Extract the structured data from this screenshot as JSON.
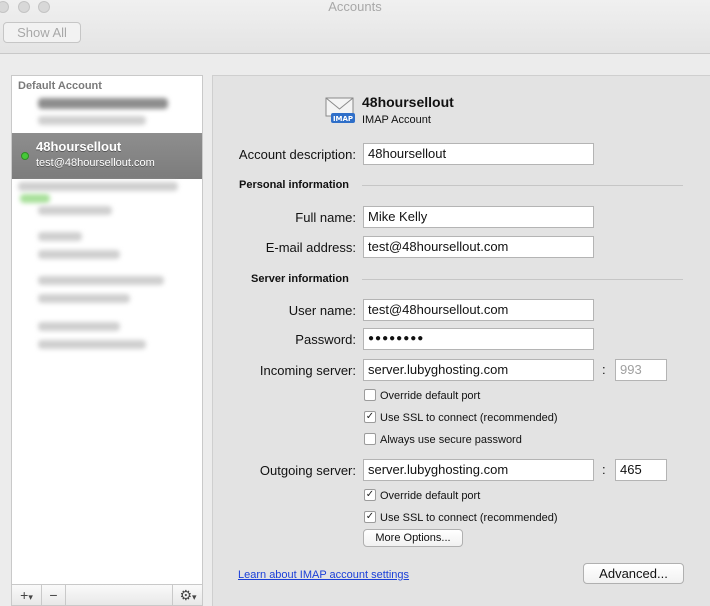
{
  "window": {
    "title": "Accounts"
  },
  "toolbar": {
    "show_all_label": "Show All"
  },
  "sidebar": {
    "header": "Default Account",
    "selected": {
      "name": "48hoursellout",
      "email": "test@48hoursellout.com"
    },
    "add_label": "+",
    "remove_label": "−",
    "add_menu_label": "▾",
    "gear_label": "⚙",
    "gear_menu_label": "▾"
  },
  "account": {
    "title": "48hoursellout",
    "type": "IMAP Account",
    "icon": "mail-envelope-icon",
    "icon_badge": "IMAP"
  },
  "form": {
    "description_label": "Account description:",
    "description_value": "48hoursellout",
    "personal_section": "Personal information",
    "fullname_label": "Full name:",
    "fullname_value": "Mike Kelly",
    "email_label": "E-mail address:",
    "email_value": "test@48hoursellout.com",
    "server_section": "Server information",
    "username_label": "User name:",
    "username_value": "test@48hoursellout.com",
    "password_label": "Password:",
    "password_value": "●●●●●●●●",
    "incoming_label": "Incoming server:",
    "incoming_value": "server.lubyghosting.com",
    "incoming_port": "993",
    "incoming_override": {
      "label": "Override default port",
      "checked": false
    },
    "incoming_ssl": {
      "label": "Use SSL to connect (recommended)",
      "checked": true
    },
    "incoming_secure_pw": {
      "label": "Always use secure password",
      "checked": false
    },
    "outgoing_label": "Outgoing server:",
    "outgoing_value": "server.lubyghosting.com",
    "outgoing_port": "465",
    "outgoing_override": {
      "label": "Override default port",
      "checked": true
    },
    "outgoing_ssl": {
      "label": "Use SSL to connect (recommended)",
      "checked": true
    },
    "more_options_label": "More Options...",
    "colon": ":",
    "check_mark": "✓"
  },
  "footer": {
    "learn_link": "Learn about IMAP account settings",
    "advanced_label": "Advanced..."
  },
  "colors": {
    "selection": "#858585",
    "online": "#46c838",
    "link": "#1a3fd8"
  }
}
